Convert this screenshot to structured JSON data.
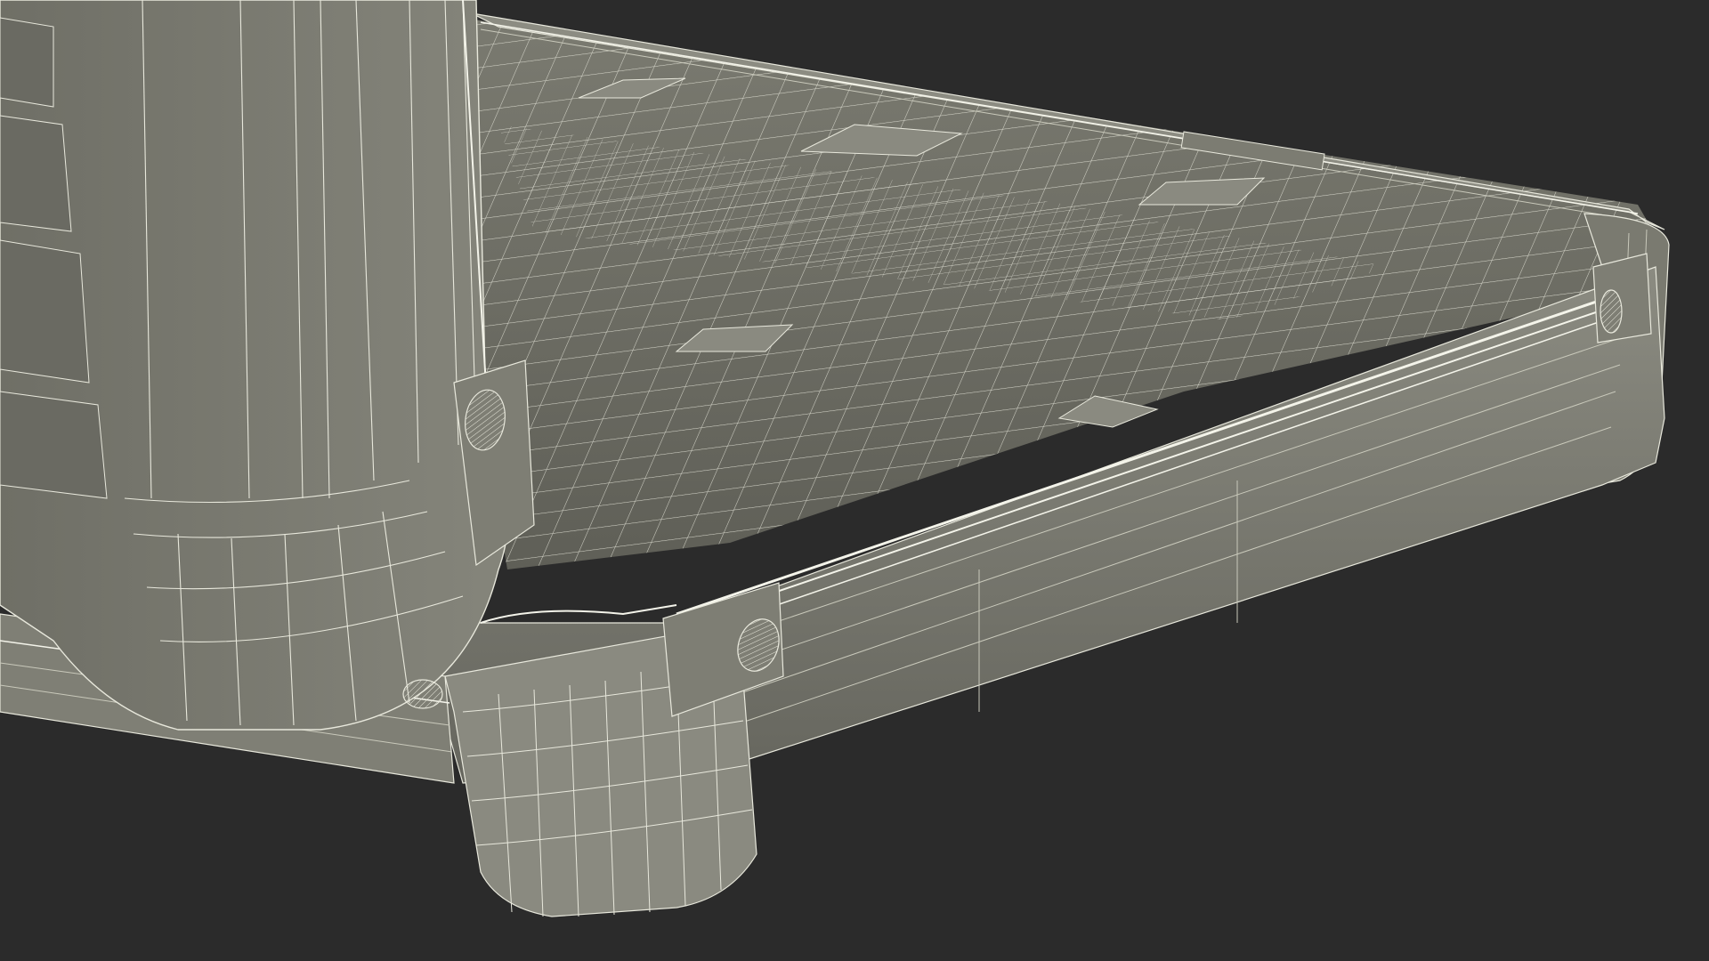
{
  "scene": {
    "subject": "wireframe-case",
    "colors": {
      "background": "#2b2b2b",
      "surface": "#7c7c72",
      "surface_light": "#8a8a80",
      "surface_dark": "#5e5e56",
      "wire": "#e8e8dc",
      "wire_dim": "#c9c9bb",
      "edge_highlight": "#f4f4ea"
    }
  }
}
